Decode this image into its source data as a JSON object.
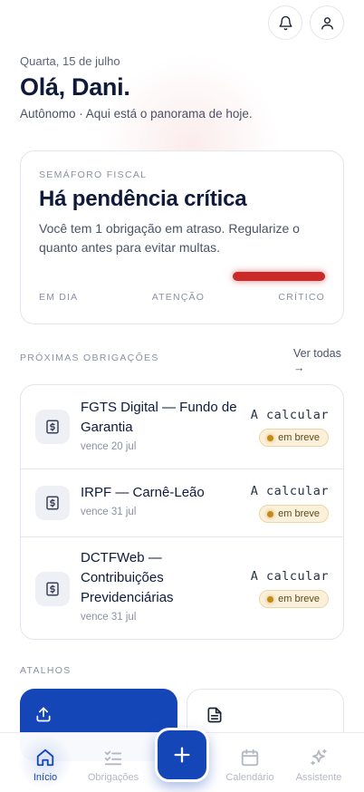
{
  "header": {
    "date": "Quarta, 15 de julho",
    "greeting": "Olá, Dani.",
    "subtitle": "Autônomo · Aqui está o panorama de hoje."
  },
  "fiscal_light": {
    "eyebrow": "SEMÁFORO FISCAL",
    "title": "Há pendência crítica",
    "description": "Você tem 1 obrigação em atraso. Regularize o quanto antes para evitar multas.",
    "levels": [
      "EM DIA",
      "ATENÇÃO",
      "CRÍTICO"
    ],
    "active_level": "CRÍTICO",
    "active_color": "#c92a2a"
  },
  "obligations": {
    "section_label": "PRÓXIMAS OBRIGAÇÕES",
    "see_all": "Ver todas",
    "see_all_arrow": "→",
    "items": [
      {
        "title": "FGTS Digital — Fundo de Garantia",
        "due": "vence 20 jul",
        "amount": "A calcular",
        "status": "em breve"
      },
      {
        "title": "IRPF — Carnê-Leão",
        "due": "vence 31 jul",
        "amount": "A calcular",
        "status": "em breve"
      },
      {
        "title": "DCTFWeb — Contribuições Previdenciárias",
        "due": "vence 31 jul",
        "amount": "A calcular",
        "status": "em breve"
      }
    ]
  },
  "shortcuts": {
    "section_label": "ATALHOS"
  },
  "tabbar": {
    "tabs": [
      {
        "label": "Início",
        "icon": "home-icon"
      },
      {
        "label": "Obrigações",
        "icon": "checklist-icon"
      },
      {
        "label": "Calendário",
        "icon": "calendar-icon"
      },
      {
        "label": "Assistente",
        "icon": "sparkles-icon"
      }
    ],
    "active": "Início",
    "accent_color": "#1446b8"
  }
}
